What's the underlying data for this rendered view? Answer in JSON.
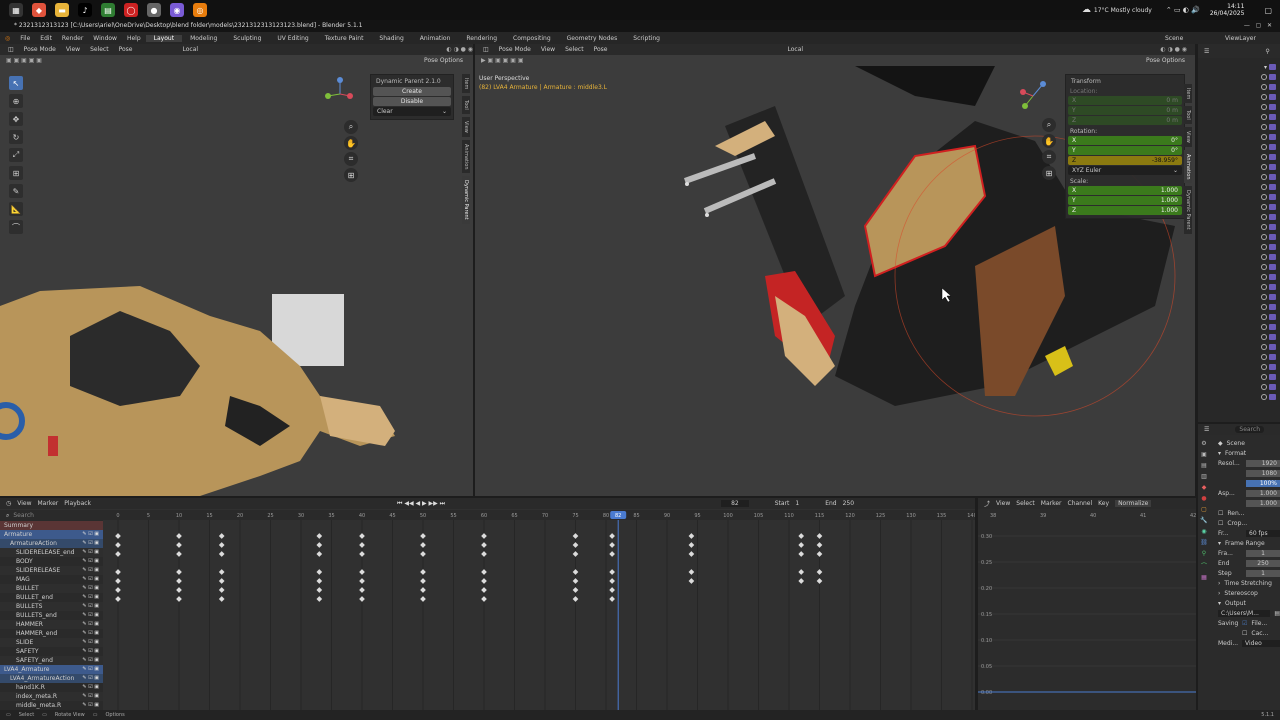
{
  "taskbar": {
    "weather": "17°C  Mostly cloudy",
    "time": "14:11",
    "date": "26/04/2025",
    "icons": [
      "brave-icon",
      "files-icon",
      "tiktok-icon",
      "xbox-icon",
      "circle-icon",
      "chrome-icon",
      "messenger-icon",
      "blender-icon"
    ]
  },
  "window": {
    "title": "* 2321312313123 [C:\\Users\\ariel\\OneDrive\\Desktop\\blend folder\\models\\2321312313123123.blend] - Blender 5.1.1"
  },
  "menu": {
    "items": [
      "File",
      "Edit",
      "Render",
      "Window",
      "Help"
    ],
    "workspaces": [
      "Layout",
      "Modeling",
      "Sculpting",
      "UV Editing",
      "Texture Paint",
      "Shading",
      "Animation",
      "Rendering",
      "Compositing",
      "Geometry Nodes",
      "Scripting"
    ],
    "active_workspace": "Layout",
    "scene": "Scene",
    "view_layer": "ViewLayer"
  },
  "left_viewport": {
    "mode": "Pose Mode",
    "menus": [
      "View",
      "Select",
      "Pose"
    ],
    "transform_orientation": "Local",
    "pose_options": "Pose Options",
    "panel": {
      "title": "Dynamic Parent 2.1.0",
      "create": "Create",
      "disable": "Disable",
      "clear": "Clear"
    },
    "tabs": [
      "Item",
      "Tool",
      "View",
      "Animation",
      "Dynamic Parent"
    ]
  },
  "right_viewport": {
    "mode": "Pose Mode",
    "menus": [
      "View",
      "Select",
      "Pose"
    ],
    "transform_orientation": "Local",
    "pose_options": "Pose Options",
    "perspective_label": "User Perspective",
    "object_label": "(82) LVA4 Armature | Armature : middle3.L",
    "transform": {
      "title": "Transform",
      "location_label": "Location:",
      "location": [
        {
          "axis": "X",
          "value": "0 m"
        },
        {
          "axis": "Y",
          "value": "0 m"
        },
        {
          "axis": "Z",
          "value": "0 m"
        }
      ],
      "rotation_label": "Rotation:",
      "rotation": [
        {
          "axis": "X",
          "value": "0°"
        },
        {
          "axis": "Y",
          "value": "0°"
        },
        {
          "axis": "Z",
          "value": "-38.959°"
        }
      ],
      "euler": "XYZ Euler",
      "scale_label": "Scale:",
      "scale": [
        {
          "axis": "X",
          "value": "1.000"
        },
        {
          "axis": "Y",
          "value": "1.000"
        },
        {
          "axis": "Z",
          "value": "1.000"
        }
      ]
    },
    "tabs": [
      "Item",
      "Tool",
      "View",
      "Animation",
      "Dynamic Parent"
    ]
  },
  "properties": {
    "search_placeholder": "Search",
    "scene_label": "Scene",
    "format_label": "Format",
    "res_label": "Resol...",
    "res_x": "1920",
    "res_y": "1080",
    "res_pct": "100%",
    "aspect_label": "Asp...",
    "aspect_x": "1.000",
    "aspect_y": "1.000",
    "render_region": "Ren...",
    "crop": "Crop...",
    "fps_label": "Fr...",
    "fps": "60 fps",
    "frame_range_label": "Frame Range",
    "frame_start_label": "Fra...",
    "frame_start": "1",
    "end_label": "End",
    "end": "250",
    "step_label": "Step",
    "step": "1",
    "time_stretching": "Time Stretching",
    "stereoscopy": "Stereoscop",
    "output_label": "Output",
    "output_path": "C:\\Users\\M...",
    "saving_label": "Saving",
    "file_label": "File...",
    "cache_label": "Cac...",
    "media_label": "Medi...",
    "video_label": "Video"
  },
  "timeline": {
    "menus": [
      "View",
      "Marker",
      "Playback"
    ],
    "current_frame": "82",
    "start_label": "Start",
    "start": "1",
    "end_label": "End",
    "end": "250",
    "ticks": [
      "0",
      "5",
      "10",
      "15",
      "20",
      "25",
      "30",
      "35",
      "40",
      "45",
      "50",
      "55",
      "60",
      "65",
      "70",
      "75",
      "80",
      "85",
      "90",
      "95",
      "100",
      "105",
      "110",
      "115",
      "120",
      "125",
      "130",
      "135",
      "140"
    ],
    "search_placeholder": "Search",
    "channels": [
      {
        "name": "Summary",
        "level": 0,
        "sel": "summary"
      },
      {
        "name": "Armature",
        "level": 0,
        "sel": "obj"
      },
      {
        "name": "ArmatureAction",
        "level": 1,
        "sel": "act"
      },
      {
        "name": "SLIDERELEASE_end",
        "level": 2,
        "sel": ""
      },
      {
        "name": "BODY",
        "level": 2,
        "sel": ""
      },
      {
        "name": "SLIDERELEASE",
        "level": 2,
        "sel": ""
      },
      {
        "name": "MAG",
        "level": 2,
        "sel": ""
      },
      {
        "name": "BULLET",
        "level": 2,
        "sel": ""
      },
      {
        "name": "BULLET_end",
        "level": 2,
        "sel": ""
      },
      {
        "name": "BULLETS",
        "level": 2,
        "sel": ""
      },
      {
        "name": "BULLETS_end",
        "level": 2,
        "sel": ""
      },
      {
        "name": "HAMMER",
        "level": 2,
        "sel": ""
      },
      {
        "name": "HAMMER_end",
        "level": 2,
        "sel": ""
      },
      {
        "name": "SLIDE",
        "level": 2,
        "sel": ""
      },
      {
        "name": "SAFETY",
        "level": 2,
        "sel": ""
      },
      {
        "name": "SAFETY_end",
        "level": 2,
        "sel": ""
      },
      {
        "name": "LVA4_Armature",
        "level": 0,
        "sel": "obj"
      },
      {
        "name": "LVA4_ArmatureAction",
        "level": 1,
        "sel": "act"
      },
      {
        "name": "hand1K.R",
        "level": 2,
        "sel": ""
      },
      {
        "name": "index_meta.R",
        "level": 2,
        "sel": ""
      },
      {
        "name": "middle_meta.R",
        "level": 2,
        "sel": ""
      }
    ]
  },
  "graph": {
    "menus": [
      "View",
      "Select",
      "Marker",
      "Channel",
      "Key"
    ],
    "normalize": "Normalize",
    "ticks_x": [
      "38",
      "39",
      "40",
      "41",
      "42"
    ],
    "ticks_y": [
      "0.30",
      "0.25",
      "0.20",
      "0.15",
      "0.10",
      "0.05",
      "0.00"
    ]
  },
  "status": {
    "select": "Select",
    "rotate": "Rotate View",
    "options": "Options",
    "version": "5.1.1"
  }
}
